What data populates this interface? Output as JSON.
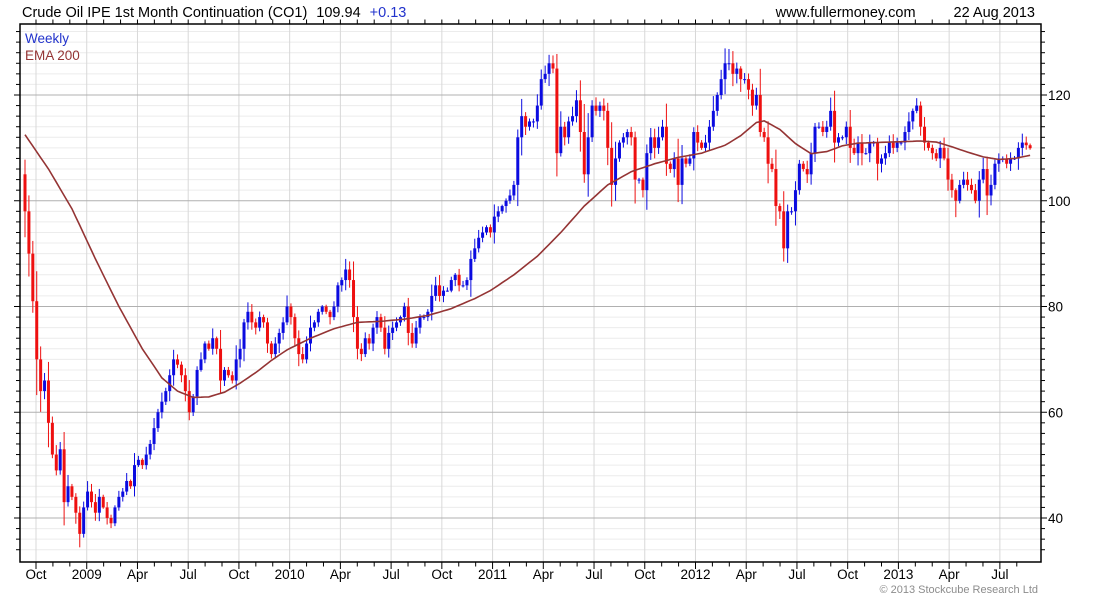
{
  "header": {
    "title": "Crude Oil IPE 1st Month Continuation (CO1)",
    "last_price": "109.94",
    "change": "+0.13",
    "site": "www.fullermoney.com",
    "date": "22 Aug 2013"
  },
  "legend": {
    "series_label": "Weekly",
    "overlay_label": "EMA 200"
  },
  "footer": {
    "copyright": "© 2013 Stockcube Research Ltd"
  },
  "colors": {
    "up": "#0b0be0",
    "down": "#ee1010",
    "ema": "#943434",
    "accent_blue": "#2233cc",
    "grid_minor": "#ececec",
    "grid_vertical": "#d8d8d8",
    "grid_major": "#b0b0b0",
    "axis": "#000000",
    "copyright_gray": "#8c8c8c"
  },
  "chart_data": {
    "type": "candlestick",
    "title": "Crude Oil IPE 1st Month Continuation (CO1)",
    "interval": "weekly",
    "first_week": "2008-09-19",
    "last_week": "2013-08-23",
    "last_close": 109.94,
    "change": 0.13,
    "y_axis": {
      "ticks": [
        40,
        60,
        80,
        100,
        120
      ],
      "minor_step": 2,
      "range_approx": [
        31.7,
        133.4
      ]
    },
    "x_axis": {
      "quarter_labels": [
        "Oct",
        "2009",
        "Apr",
        "Jul",
        "Oct",
        "2010",
        "Apr",
        "Jul",
        "Oct",
        "2011",
        "Apr",
        "Jul",
        "Oct",
        "2012",
        "Apr",
        "Jul",
        "Oct",
        "2013",
        "Apr",
        "Jul"
      ],
      "months_per_label": 3
    },
    "first_open": 105,
    "closes": [
      98,
      90,
      81,
      70,
      64,
      66,
      58,
      52,
      49,
      53,
      43,
      46,
      44,
      41,
      37,
      42,
      45,
      43,
      41,
      44,
      42,
      40,
      39,
      42,
      44,
      45,
      47,
      46,
      50,
      51,
      50,
      52,
      54,
      57,
      60,
      62,
      64,
      67,
      70,
      69,
      67,
      64,
      60,
      63,
      68,
      70,
      73,
      72,
      74,
      72,
      66,
      68,
      67,
      66,
      70,
      72,
      77,
      79,
      77,
      76,
      78,
      77,
      73,
      71,
      73,
      75,
      77,
      80,
      78,
      74,
      71,
      70,
      73,
      76,
      77,
      79,
      80,
      79,
      78,
      80,
      84,
      85,
      87,
      85,
      78,
      72,
      71,
      74,
      73,
      76,
      78,
      76,
      72,
      75,
      76,
      77,
      78,
      80,
      75,
      73,
      76,
      78,
      78,
      79,
      82,
      84,
      82,
      83,
      83,
      85,
      86,
      84,
      84,
      85,
      89,
      91,
      93,
      94,
      95,
      94,
      97,
      98,
      99,
      100,
      101,
      103,
      112,
      116,
      114,
      115,
      115,
      118,
      123,
      124,
      126,
      125,
      109,
      114,
      112,
      115,
      116,
      119,
      113,
      105,
      112,
      118,
      117,
      118,
      117,
      110,
      103,
      108,
      111,
      112,
      113,
      112,
      104,
      104,
      102,
      109,
      112,
      110,
      112,
      114,
      107,
      106,
      108,
      103,
      108,
      107,
      108,
      113,
      111,
      110,
      111,
      114,
      117,
      120,
      123,
      126,
      126,
      124,
      125,
      123,
      123,
      121,
      118,
      120,
      113,
      112,
      107,
      106,
      99,
      98,
      91,
      98,
      98,
      102,
      107,
      106,
      105,
      109,
      114,
      114,
      113,
      114,
      117,
      111,
      112,
      112,
      114,
      110,
      109,
      111,
      109,
      109,
      111,
      111,
      107,
      108,
      109,
      111,
      110,
      111,
      111,
      113,
      115,
      117,
      118,
      114,
      111,
      110,
      109,
      108,
      110,
      108,
      104,
      102,
      100,
      103,
      104,
      103,
      102,
      100,
      104,
      106,
      101,
      103,
      107,
      108,
      108,
      107,
      108,
      108,
      110,
      111,
      110.5,
      109.94
    ],
    "wick_overrides": {
      "15": {
        "low": 36.3
      },
      "82": {
        "high": 89
      },
      "134": {
        "high": 127.6
      },
      "136": {
        "low": 104.6
      },
      "150": {
        "low": 98.9
      },
      "180": {
        "high": 128.7
      },
      "194": {
        "low": 88.5
      },
      "228": {
        "high": 119.4
      },
      "238": {
        "low": 96.9
      }
    },
    "ema": {
      "label": "EMA 200",
      "anchors": [
        [
          0,
          112.5
        ],
        [
          6,
          106
        ],
        [
          12,
          98.5
        ],
        [
          18,
          89
        ],
        [
          24,
          80
        ],
        [
          30,
          72
        ],
        [
          35,
          66.5
        ],
        [
          39,
          64
        ],
        [
          43,
          62.8
        ],
        [
          47,
          62.9
        ],
        [
          51,
          63.8
        ],
        [
          55,
          65.5
        ],
        [
          59,
          67.5
        ],
        [
          63,
          69.8
        ],
        [
          67,
          71.8
        ],
        [
          73,
          74
        ],
        [
          79,
          75.8
        ],
        [
          85,
          77
        ],
        [
          91,
          77.2
        ],
        [
          97,
          77.6
        ],
        [
          103,
          78.3
        ],
        [
          109,
          79.6
        ],
        [
          115,
          81.5
        ],
        [
          119,
          83
        ],
        [
          125,
          86
        ],
        [
          131,
          89.5
        ],
        [
          137,
          94
        ],
        [
          143,
          99
        ],
        [
          149,
          103
        ],
        [
          155,
          105.5
        ],
        [
          161,
          107
        ],
        [
          167,
          108.2
        ],
        [
          173,
          109
        ],
        [
          179,
          110.5
        ],
        [
          183,
          112.3
        ],
        [
          187,
          114.8
        ],
        [
          189,
          115.1
        ],
        [
          193,
          113.5
        ],
        [
          197,
          110.8
        ],
        [
          201,
          108.9
        ],
        [
          205,
          109.3
        ],
        [
          209,
          110.4
        ],
        [
          213,
          110.9
        ],
        [
          221,
          111.1
        ],
        [
          229,
          111.3
        ],
        [
          233,
          111.1
        ],
        [
          237,
          110.2
        ],
        [
          241,
          109.2
        ],
        [
          245,
          108.3
        ],
        [
          249,
          107.8
        ],
        [
          253,
          108
        ],
        [
          257,
          108.6
        ]
      ]
    }
  }
}
